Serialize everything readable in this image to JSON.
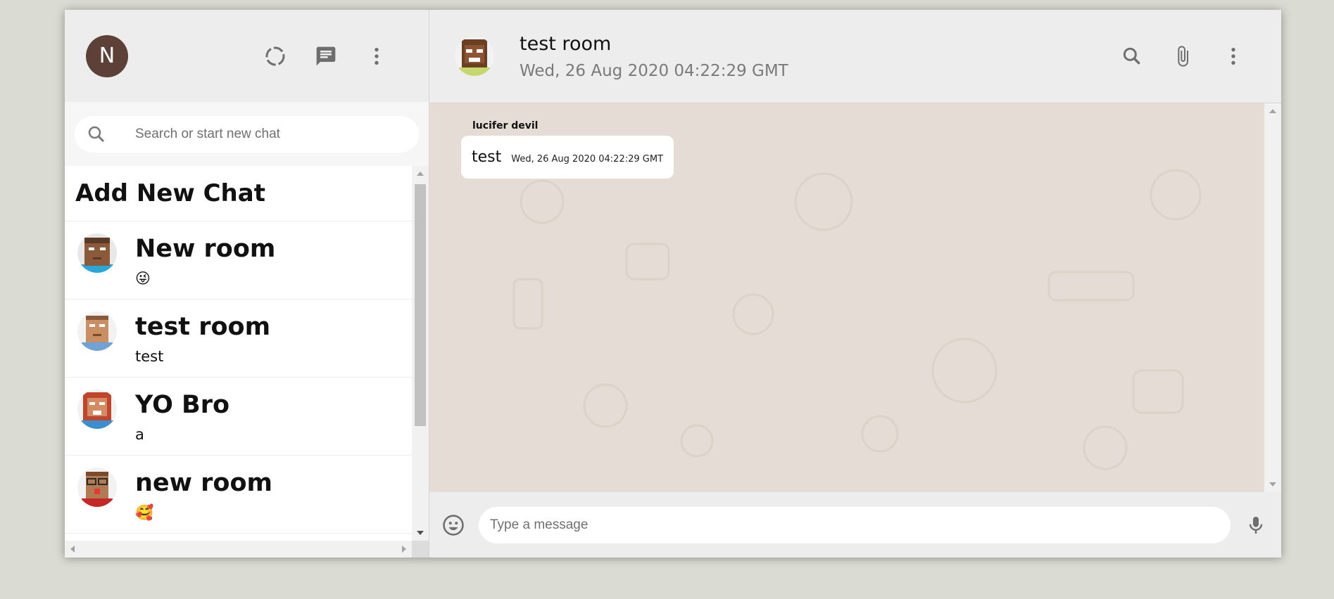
{
  "user": {
    "avatar_initial": "N"
  },
  "sidebar": {
    "search_placeholder": "Search or start new chat",
    "add_new_chat_label": "Add New Chat",
    "chats": [
      {
        "name": "New room",
        "last_message": "😜"
      },
      {
        "name": "test room",
        "last_message": "test"
      },
      {
        "name": "YO Bro",
        "last_message": "a"
      },
      {
        "name": "new room",
        "last_message": "🥰"
      }
    ]
  },
  "chat": {
    "title": "test room",
    "subtitle": "Wed, 26 Aug 2020 04:22:29 GMT",
    "messages": [
      {
        "author": "lucifer devil",
        "text": "test",
        "time": "Wed, 26 Aug 2020 04:22:29 GMT"
      }
    ],
    "input_placeholder": "Type a message"
  },
  "icons": {
    "status": "status-icon",
    "new_chat": "chat-icon",
    "menu": "more-vert-icon",
    "search": "search-icon",
    "attach": "attach-icon",
    "emoji": "emoji-icon",
    "mic": "mic-icon"
  },
  "colors": {
    "background": "#dadbd3",
    "panel": "#ededed",
    "chat_bg": "#e5ddd5",
    "avatar": "#5d4037"
  }
}
